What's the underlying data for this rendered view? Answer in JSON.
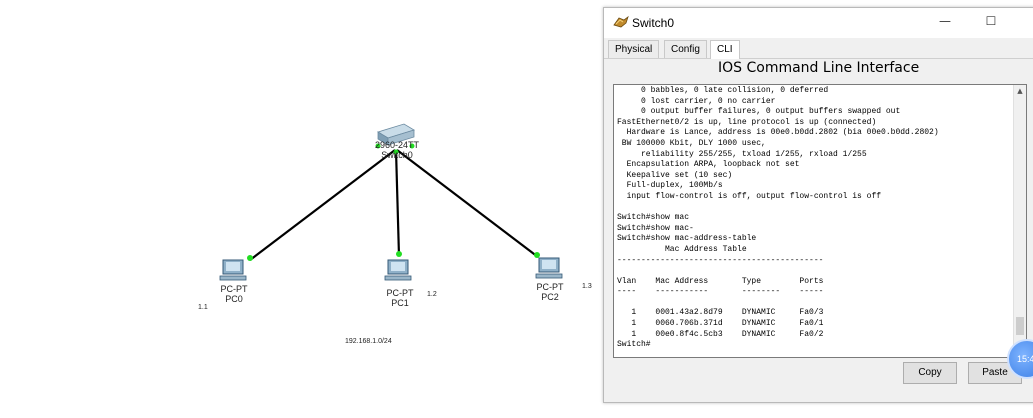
{
  "topology": {
    "switch": {
      "model": "2960-24TT",
      "name": "Switch0"
    },
    "pcs": [
      {
        "type": "PC-PT",
        "name": "PC0",
        "addr": "1.1"
      },
      {
        "type": "PC-PT",
        "name": "PC1",
        "addr": "1.2"
      },
      {
        "type": "PC-PT",
        "name": "PC2",
        "addr": "1.3"
      }
    ],
    "network": "192.168.1.0/24",
    "link_color": "#000000",
    "port_color": "#22dd22"
  },
  "window": {
    "title": "Switch0",
    "controls": {
      "minimize": "—",
      "maximize": "☐",
      "close": "✕"
    },
    "tabs": [
      {
        "label": "Physical",
        "active": false
      },
      {
        "label": "Config",
        "active": false
      },
      {
        "label": "CLI",
        "active": true
      }
    ],
    "heading": "IOS Command Line Interface",
    "console_lines": [
      "     0 babbles, 0 late collision, 0 deferred",
      "     0 lost carrier, 0 no carrier",
      "     0 output buffer failures, 0 output buffers swapped out",
      "FastEthernet0/2 is up, line protocol is up (connected)",
      "  Hardware is Lance, address is 00e0.b0dd.2802 (bia 00e0.b0dd.2802)",
      " BW 100000 Kbit, DLY 1000 usec,",
      "     reliability 255/255, txload 1/255, rxload 1/255",
      "  Encapsulation ARPA, loopback not set",
      "  Keepalive set (10 sec)",
      "  Full-duplex, 100Mb/s",
      "  input flow-control is off, output flow-control is off",
      "",
      "Switch#show mac",
      "Switch#show mac-",
      "Switch#show mac-address-table",
      "          Mac Address Table",
      "-------------------------------------------",
      "",
      "Vlan    Mac Address       Type        Ports",
      "----    -----------       --------    -----",
      "",
      "   1    0001.43a2.8d79    DYNAMIC     Fa0/3",
      "   1    0060.706b.371d    DYNAMIC     Fa0/1",
      "   1    00e0.8f4c.5cb3    DYNAMIC     Fa0/2",
      "Switch#"
    ],
    "buttons": {
      "copy": "Copy",
      "paste": "Paste"
    },
    "clock": "15:4"
  }
}
